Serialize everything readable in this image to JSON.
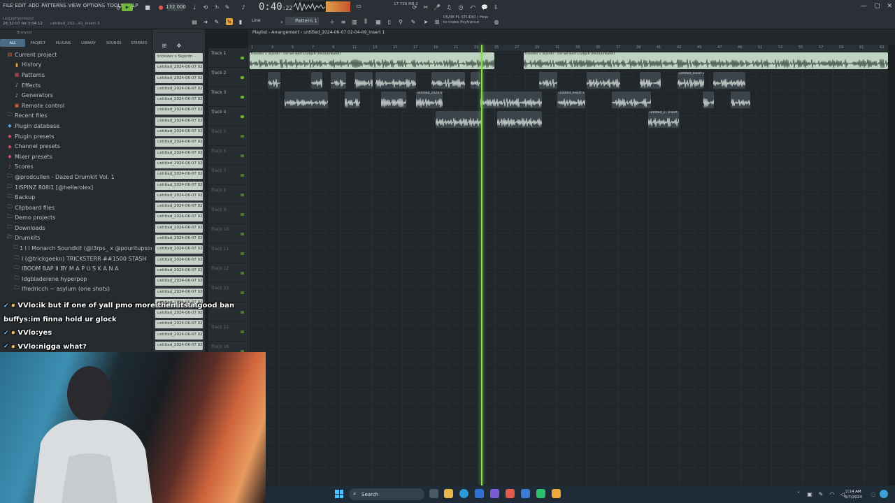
{
  "menu": [
    "FILE",
    "EDIT",
    "ADD",
    "PATTERNS",
    "VIEW",
    "OPTIONS",
    "TOOLS",
    "HELP"
  ],
  "hint": {
    "user": "LouLeeHammond",
    "time": "26:32:07 for 3:04:12",
    "file": "untitled_202...41_Insert 3"
  },
  "transport": {
    "tempo": "132.000",
    "time_main": "0:40",
    "time_sub": "22",
    "snap": "Line",
    "pattern": "Pattern 1",
    "cpu": "736 MB\n2",
    "cpu_num": "17"
  },
  "news": {
    "line1": "05/08  FL STUDIO | How",
    "line2": "to make Psytrance"
  },
  "window_controls": [
    "—",
    "▢",
    "✕"
  ],
  "browser": {
    "label": "Browser",
    "tabs": [
      "ALL",
      "PROJECT",
      "PLUGINS",
      "LIBRARY",
      "SOUNDS",
      "STARRED"
    ],
    "active_tab": "ALL",
    "items": [
      {
        "label": "Current project",
        "icon": "project-icon",
        "lvl": 0,
        "color": "#e1623e"
      },
      {
        "label": "History",
        "icon": "history-icon",
        "lvl": 1,
        "color": "#e6a23c"
      },
      {
        "label": "Patterns",
        "icon": "patterns-icon",
        "lvl": 1,
        "color": "#d44f66"
      },
      {
        "label": "Effects",
        "icon": "effects-icon",
        "lvl": 1,
        "color": "#7fc2dd"
      },
      {
        "label": "Generators",
        "icon": "generators-icon",
        "lvl": 1,
        "color": "#7fc2dd"
      },
      {
        "label": "Remote control",
        "icon": "remote-icon",
        "lvl": 1,
        "color": "#e1623e"
      },
      {
        "label": "Recent files",
        "icon": "folder-icon",
        "lvl": 0,
        "color": "#8fb3c2"
      },
      {
        "label": "Plugin database",
        "icon": "plugin-db-icon",
        "lvl": 0,
        "color": "#5ea0d6"
      },
      {
        "label": "Plugin presets",
        "icon": "plugin-presets-icon",
        "lvl": 0,
        "color": "#d44f66"
      },
      {
        "label": "Channel presets",
        "icon": "channel-presets-icon",
        "lvl": 0,
        "color": "#d44f66"
      },
      {
        "label": "Mixer presets",
        "icon": "mixer-presets-icon",
        "lvl": 0,
        "color": "#d44f66"
      },
      {
        "label": "Scores",
        "icon": "scores-icon",
        "lvl": 0,
        "color": "#d44f66"
      },
      {
        "label": "@prodcullen - Dazed Drumkit Vol. 1",
        "icon": "folder-icon",
        "lvl": 0,
        "color": "#9fb0ba"
      },
      {
        "label": "1ISPINZ 808l1 [@hellarolex]",
        "icon": "folder-icon",
        "lvl": 0,
        "color": "#9fb0ba"
      },
      {
        "label": "Backup",
        "icon": "folder-icon",
        "lvl": 0,
        "color": "#9fb0ba"
      },
      {
        "label": "Clipboard files",
        "icon": "folder-icon",
        "lvl": 0,
        "color": "#9fb0ba"
      },
      {
        "label": "Demo projects",
        "icon": "folder-icon",
        "lvl": 0,
        "color": "#9fb0ba"
      },
      {
        "label": "Downloads",
        "icon": "folder-icon",
        "lvl": 0,
        "color": "#9fb0ba"
      },
      {
        "label": "Drumkits",
        "icon": "folder-open-icon",
        "lvl": 0,
        "color": "#9fb0ba"
      },
      {
        "label": "1 l l Monarch Soundkit (@l3rps_ x @pouritupsoda)",
        "icon": "folder-icon",
        "lvl": 1,
        "color": "#9fb0ba"
      },
      {
        "label": "l (@trickgeekn) TRICKSTERR ##1500 STASH",
        "icon": "folder-icon",
        "lvl": 1,
        "color": "#9fb0ba"
      },
      {
        "label": "IBOOM BAP II BY M A P U S K A N A",
        "icon": "folder-icon",
        "lvl": 1,
        "color": "#9fb0ba"
      },
      {
        "label": "Idgbladerene hyperpop",
        "icon": "folder-icon",
        "lvl": 1,
        "color": "#9fb0ba"
      },
      {
        "label": "Ifredricch ~ asylum (one shots)",
        "icon": "folder-icon",
        "lvl": 1,
        "color": "#9fb0ba"
      }
    ]
  },
  "channels": [
    "trickster x 5kjordn -",
    "untitled_2024-06-07 02-",
    "untitled_2024-06-07 02-",
    "untitled_2024-06-07 02-",
    "untitled_2024-06-07 02-",
    "untitled_2024-06-07 02-",
    "untitled_2024-06-07 02-",
    "untitled_2024-06-07 02-",
    "untitled_2024-06-07 02-",
    "untitled_2024-06-07 02-",
    "untitled_2024-06-07 02-",
    "untitled_2024-06-07 02-",
    "untitled_2024-06-07 02-",
    "untitled_2024-06-07 02-",
    "untitled_2024-06-07 02-",
    "untitled_2024-06-07 02-",
    "untitled_2024-06-07 02-",
    "untitled_2024-06-07 02-",
    "untitled_2024-06-07 02-",
    "untitled_2024-06-07 02-",
    "untitled_2024-06-07 02-",
    "untitled_2024-06-07 02-",
    "untitled_2024-06-07 02-",
    "untitled_2024-06-07 02-",
    "untitled_2024-06-07 02-",
    "untitled_2024-06-07 02-",
    "untitled_2024-06-07 02-",
    "untitled_2024-06-07 02-",
    "untitled_2024-06-07 02-"
  ],
  "tracks": [
    "Track 1",
    "Track 2",
    "Track 3",
    "Track 4",
    "Track 5",
    "Track 6",
    "Track 7",
    "Track 8",
    "Track 9",
    "Track 10",
    "Track 11",
    "Track 12",
    "Track 13",
    "Track 14",
    "Track 15",
    "Track 16"
  ],
  "playlist": {
    "title": "Playlist - Arrangement",
    "path": "untitled_2024-06-07 02-04-09_Insert 1",
    "ruler_marks": [
      "1",
      "3",
      "5",
      "7",
      "9",
      "11",
      "13",
      "15",
      "17",
      "19",
      "21",
      "23",
      "25",
      "27",
      "29",
      "31",
      "33",
      "35",
      "37",
      "39",
      "41",
      "43",
      "45",
      "47",
      "49",
      "51",
      "53",
      "55",
      "57",
      "59",
      "61",
      "63"
    ],
    "playhead_bar": 22,
    "clip_label_main": "trickster x 5kjordn - can we wait 132bpm (min)(ambient)",
    "clip_label_right": "trickster x 5kjordn - can we wait 132bpm (min)(ambient)",
    "clip_label_right2": "tricks (ambient)",
    "clip_labels": [
      "untitled_2024-0...08-48_Insert 1",
      "untitled_Insert 1",
      "untitled_2...Insert 1",
      "untitled_Insert 1"
    ]
  },
  "chat": [
    {
      "user": "VVlo",
      "text": "ik but if one of yall pmo more then its a good ban",
      "badge": true
    },
    {
      "user": "buffys",
      "text": "im finna hold ur glock",
      "badge": false
    },
    {
      "user": "VVlo",
      "text": "yes",
      "badge": true
    },
    {
      "user": "VVlo",
      "text": "nigga what?",
      "badge": true
    }
  ],
  "taskbar": {
    "search": "Search",
    "clock_time": "2:14 AM",
    "clock_date": "6/7/2024"
  },
  "colors": {
    "accent_green": "#86e04c",
    "clip_light": "#bfd3c3",
    "browser_active_tab": "#4a6b86"
  }
}
